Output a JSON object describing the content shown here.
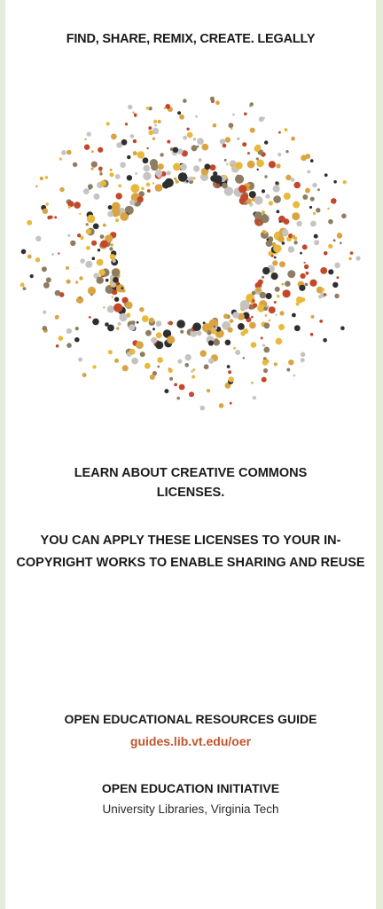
{
  "header": {
    "title": "FIND, SHARE, REMIX, CREATE. LEGALLY"
  },
  "intro": {
    "learn": "LEARN ABOUT CREATIVE COMMONS LICENSES.",
    "apply": "YOU CAN APPLY THESE LICENSES TO YOUR IN-COPYRIGHT WORKS TO ENABLE SHARING AND REUSE"
  },
  "guide": {
    "title": "OPEN EDUCATIONAL RESOURCES GUIDE",
    "link": "guides.lib.vt.edu/oer"
  },
  "initiative": {
    "title": "OPEN EDUCATION INITIATIVE",
    "subtitle": "University Libraries, Virginia Tech"
  },
  "colors": {
    "accent": "#c3532a",
    "page_background": "#e4edd9",
    "dot_palette": [
      "#e8b93b",
      "#c4472a",
      "#2f2f30",
      "#8d7d62",
      "#c5c4c2",
      "#d9a441"
    ]
  }
}
